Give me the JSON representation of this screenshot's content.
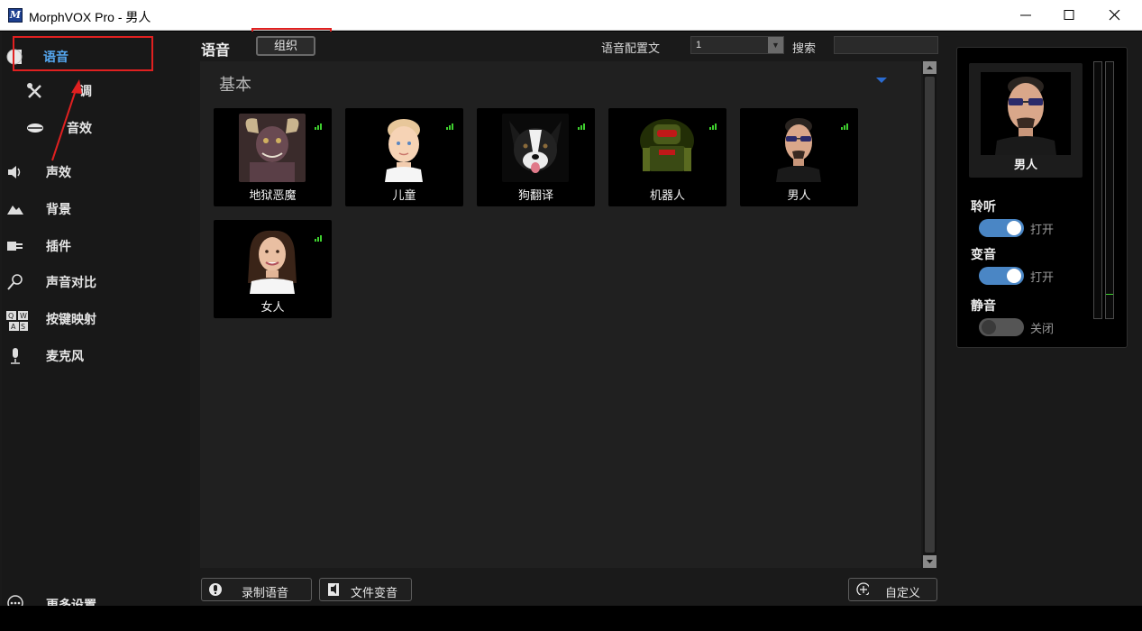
{
  "window": {
    "title": "MorphVOX Pro - 男人",
    "icon": "morphvox-app-icon"
  },
  "sidebar": {
    "items": [
      {
        "label": "语音",
        "icon": "voice-icon"
      },
      {
        "label": "调",
        "icon": "tools-icon"
      },
      {
        "label": "音效",
        "icon": "lips-icon"
      },
      {
        "label": "声效",
        "icon": "speaker-icon"
      },
      {
        "label": "背景",
        "icon": "landscape-icon"
      },
      {
        "label": "插件",
        "icon": "plugin-icon"
      },
      {
        "label": "声音对比",
        "icon": "magnifier-icon"
      },
      {
        "label": "按键映射",
        "icon": "keyboard-icon"
      },
      {
        "label": "麦克风",
        "icon": "microphone-icon"
      },
      {
        "label": "更多设置",
        "icon": "more-icon"
      }
    ]
  },
  "center": {
    "title": "语音",
    "organize_label": "组织",
    "config_label": "语音配置文",
    "config_value": "1",
    "search_label": "搜索",
    "search_value": "",
    "section_title": "基本",
    "voices": [
      {
        "name": "地狱恶魔",
        "image": "demon-portrait"
      },
      {
        "name": "儿童",
        "image": "child-portrait"
      },
      {
        "name": "狗翻译",
        "image": "dog-portrait"
      },
      {
        "name": "机器人",
        "image": "robot-portrait"
      },
      {
        "name": "男人",
        "image": "man-portrait"
      },
      {
        "name": "女人",
        "image": "woman-portrait"
      }
    ],
    "footer": {
      "record_label": "录制语音",
      "file_label": "文件变音",
      "custom_label": "自定义"
    }
  },
  "right": {
    "current_voice": "男人",
    "listen_label": "聆听",
    "listen_state": "打开",
    "morph_label": "变音",
    "morph_state": "打开",
    "mute_label": "静音",
    "mute_state": "关闭"
  },
  "colors": {
    "accent": "#55a7f0",
    "toggle_on": "#4a86c5",
    "toggle_off": "#555555",
    "highlight": "#e02020",
    "signal_green": "#3fd02f"
  }
}
